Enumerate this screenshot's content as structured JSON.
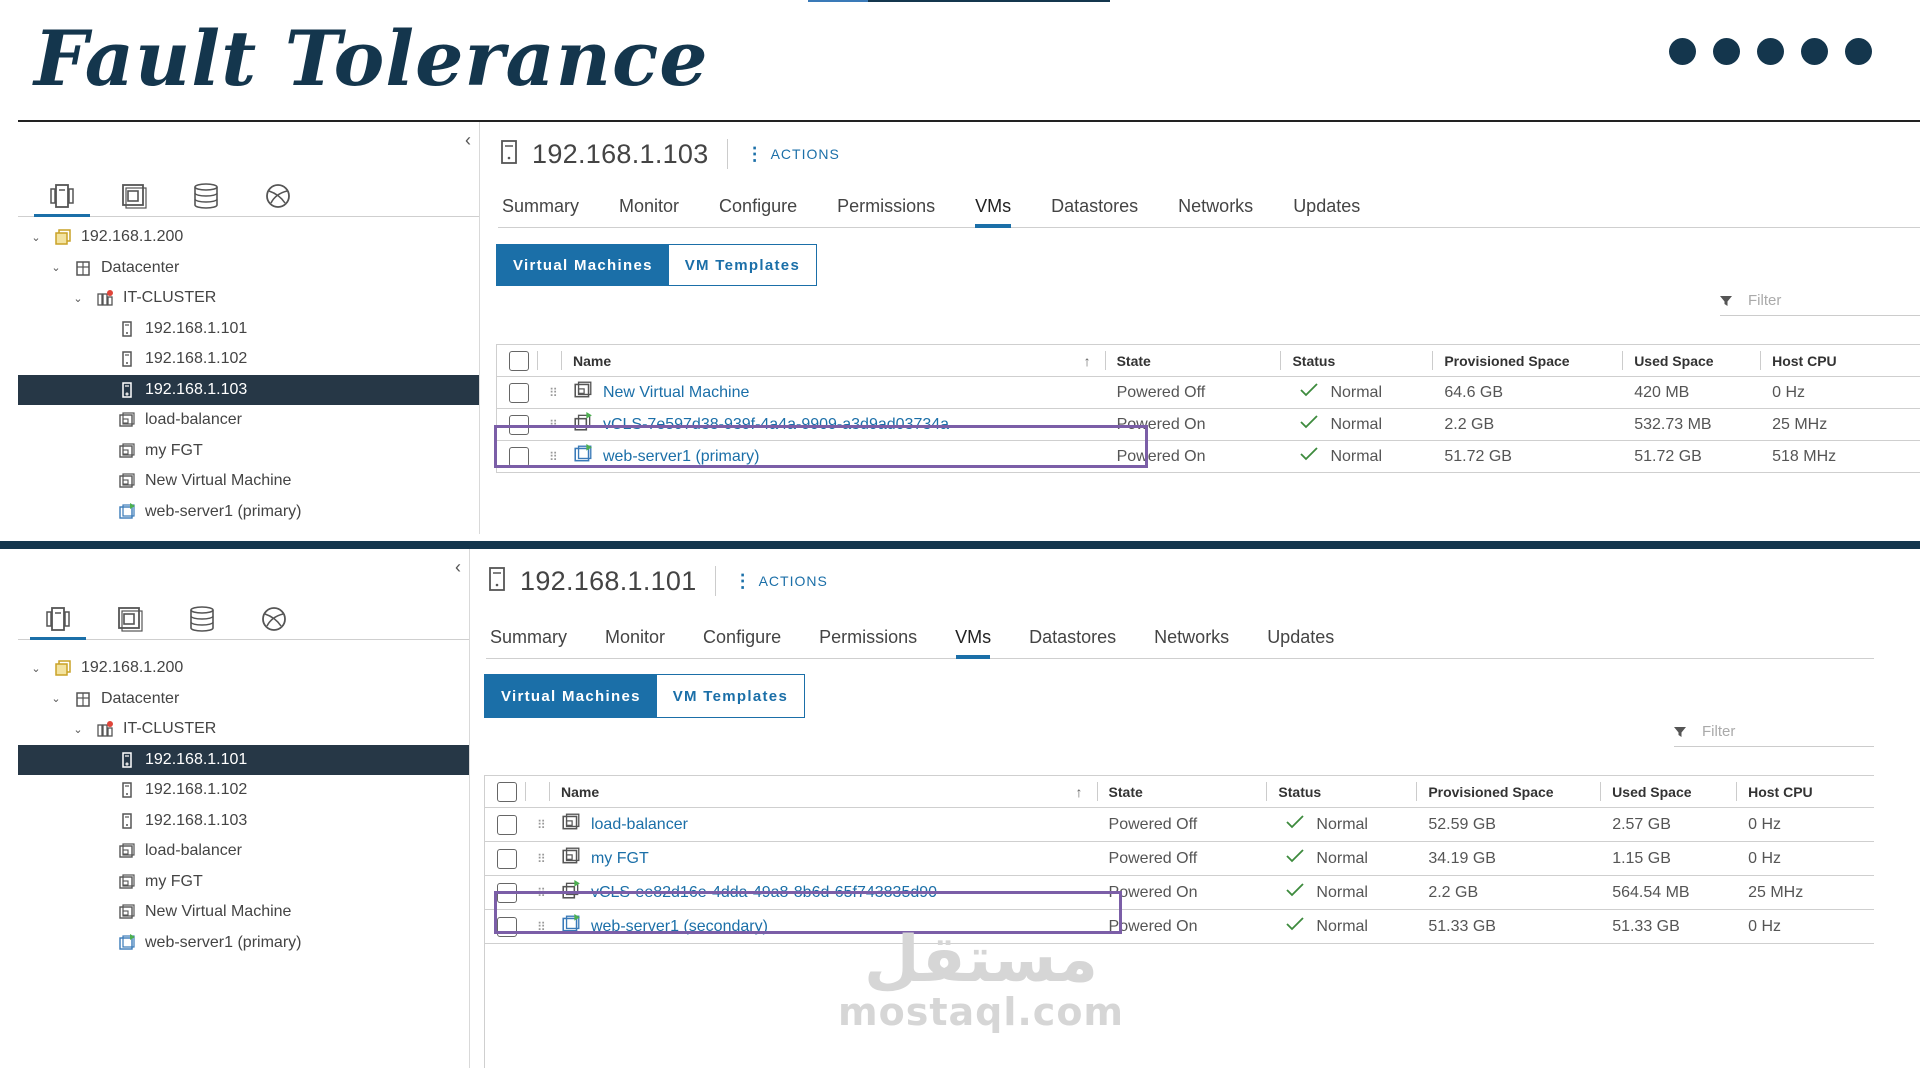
{
  "slide": {
    "title": "Fault Tolerance",
    "watermark_ar": "مستقل",
    "watermark_en": "mostaql.com"
  },
  "colors": {
    "accent": "#1b6fa8",
    "dark": "#14364d",
    "highlight": "#7b5ea7",
    "selected_row": "#263746"
  },
  "icons": {
    "host": "server-icon",
    "vm": "virtual-machine-icon",
    "vm_on": "virtual-machine-powered-on-icon",
    "cluster": "cluster-icon",
    "datacenter": "datacenter-icon",
    "vcenter": "vcenter-icon"
  },
  "common": {
    "collapse": "‹",
    "actions": "ACTIONS",
    "tabs": [
      "Summary",
      "Monitor",
      "Configure",
      "Permissions",
      "VMs",
      "Datastores",
      "Networks",
      "Updates"
    ],
    "seg_vms": "Virtual Machines",
    "seg_templates": "VM Templates",
    "filter_placeholder": "Filter",
    "columns": [
      "Name",
      "State",
      "Status",
      "Provisioned Space",
      "Used Space",
      "Host CPU"
    ],
    "tree_root": "192.168.1.200",
    "tree_dc": "Datacenter",
    "tree_cluster": "IT-CLUSTER",
    "tree_leaves": [
      "192.168.1.101",
      "192.168.1.102",
      "192.168.1.103",
      "load-balancer",
      "my FGT",
      "New Virtual Machine",
      "web-server1 (primary)"
    ]
  },
  "top": {
    "host": "192.168.1.103",
    "selected_tree": "192.168.1.103",
    "rows": [
      {
        "name": "New Virtual Machine",
        "state": "Powered Off",
        "status": "Normal",
        "prov": "64.6 GB",
        "used": "420 MB",
        "cpu": "0 Hz"
      },
      {
        "name": "vCLS-7e597d38-939f-4a4a-9909-a3d9ad03734a",
        "state": "Powered On",
        "status": "Normal",
        "prov": "2.2 GB",
        "used": "532.73 MB",
        "cpu": "25 MHz"
      },
      {
        "name": "web-server1 (primary)",
        "state": "Powered On",
        "status": "Normal",
        "prov": "51.72 GB",
        "used": "51.72 GB",
        "cpu": "518 MHz"
      }
    ]
  },
  "bottom": {
    "host": "192.168.1.101",
    "selected_tree": "192.168.1.101",
    "rows": [
      {
        "name": "load-balancer",
        "state": "Powered Off",
        "status": "Normal",
        "prov": "52.59 GB",
        "used": "2.57 GB",
        "cpu": "0 Hz"
      },
      {
        "name": "my FGT",
        "state": "Powered Off",
        "status": "Normal",
        "prov": "34.19 GB",
        "used": "1.15 GB",
        "cpu": "0 Hz"
      },
      {
        "name": "vCLS-ee82d16e-4dda-49a8-8b6d-65f743835d90",
        "state": "Powered On",
        "status": "Normal",
        "prov": "2.2 GB",
        "used": "564.54 MB",
        "cpu": "25 MHz"
      },
      {
        "name": "web-server1 (secondary)",
        "state": "Powered On",
        "status": "Normal",
        "prov": "51.33 GB",
        "used": "51.33 GB",
        "cpu": "0 Hz"
      }
    ]
  }
}
